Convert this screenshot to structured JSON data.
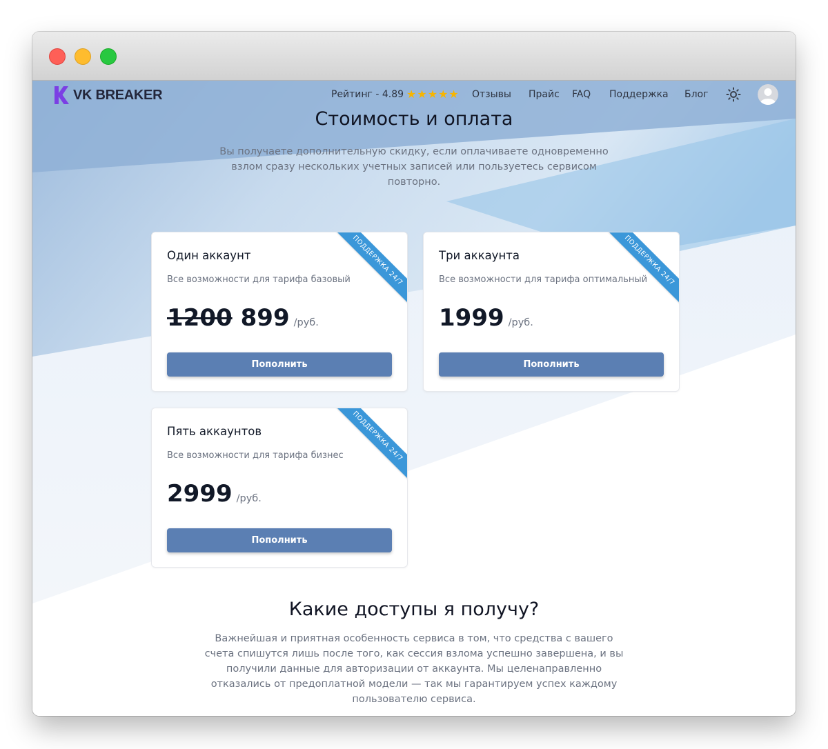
{
  "header": {
    "logo_text": "VK BREAKER",
    "rating_label": "Рейтинг - 4.89",
    "rating_stars": "★★★★★",
    "nav": [
      "Отзывы",
      "Прайс",
      "FAQ",
      "Поддержка",
      "Блог"
    ]
  },
  "pricing": {
    "title": "Стоимость и оплата",
    "subtitle_lines": [
      "Вы получаете дополнительную скидку, если оплачиваете одновременно",
      "взлом сразу нескольких учетных записей или пользуетесь сервисом",
      "повторно."
    ],
    "ribbon": "ПОДДЕРЖКА 24/7",
    "currency_unit": "/руб.",
    "button_label": "Пополнить",
    "plans": [
      {
        "name": "Один аккаунт",
        "description": "Все возможности для тарифа базовый",
        "old_price": "1200",
        "price": "899"
      },
      {
        "name": "Три аккаунта",
        "description": "Все возможности для тарифа оптимальный",
        "price": "1999"
      },
      {
        "name": "Пять аккаунтов",
        "description": "Все возможности для тарифа бизнес",
        "price": "2999"
      }
    ]
  },
  "access": {
    "title": "Какие доступы я получу?",
    "text_lines": [
      "Важнейшая и приятная особенность сервиса в том, что средства с вашего",
      "счета спишутся лишь после того, как сессия взлома успешно завершена, и вы",
      "получили данные для авторизации от аккаунта. Мы целенаправленно",
      "отказались от предоплатной модели — так мы гарантируем успех каждому",
      "пользователю сервиса."
    ]
  },
  "colors": {
    "accent_button": "#5b7fb3",
    "ribbon": "#3b97d9",
    "logo_purple": "#7b3fe4",
    "stars": "#f7b500"
  }
}
